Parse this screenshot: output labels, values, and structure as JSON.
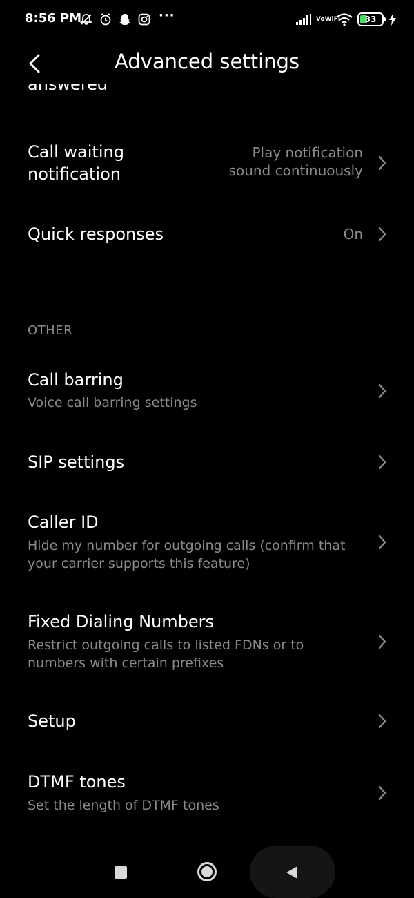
{
  "status_bar": {
    "time": "8:56 PM",
    "left_icons": [
      "mute-icon",
      "alarm-icon",
      "snapchat-icon",
      "instagram-icon"
    ],
    "more": "···",
    "vowifi_top": "Vo",
    "vowifi_bottom": "WiFi",
    "battery_level": "33"
  },
  "header": {
    "title": "Advanced settings"
  },
  "settings": {
    "cutoff_text": "answered",
    "call_waiting": {
      "title_line1": "Call waiting",
      "title_line2": "notification",
      "value_line1": "Play notification",
      "value_line2": "sound continuously"
    },
    "quick_responses": {
      "title": "Quick responses",
      "value": "On"
    },
    "section_other": "OTHER",
    "call_barring": {
      "title": "Call barring",
      "subtitle": "Voice call barring settings"
    },
    "sip_settings": {
      "title": "SIP settings"
    },
    "caller_id": {
      "title": "Caller ID",
      "subtitle": "Hide my number for outgoing calls (confirm that your carrier supports this feature)"
    },
    "fdn": {
      "title": "Fixed Dialing Numbers",
      "subtitle": "Restrict outgoing calls to listed FDNs or to numbers with certain prefixes"
    },
    "setup": {
      "title": "Setup"
    },
    "dtmf": {
      "title": "DTMF tones",
      "subtitle": "Set the length of DTMF tones"
    }
  },
  "colors": {
    "background": "#000000",
    "primary_text": "#ffffff",
    "secondary_text": "#8a8a8a",
    "battery_fill": "#4cd964"
  }
}
